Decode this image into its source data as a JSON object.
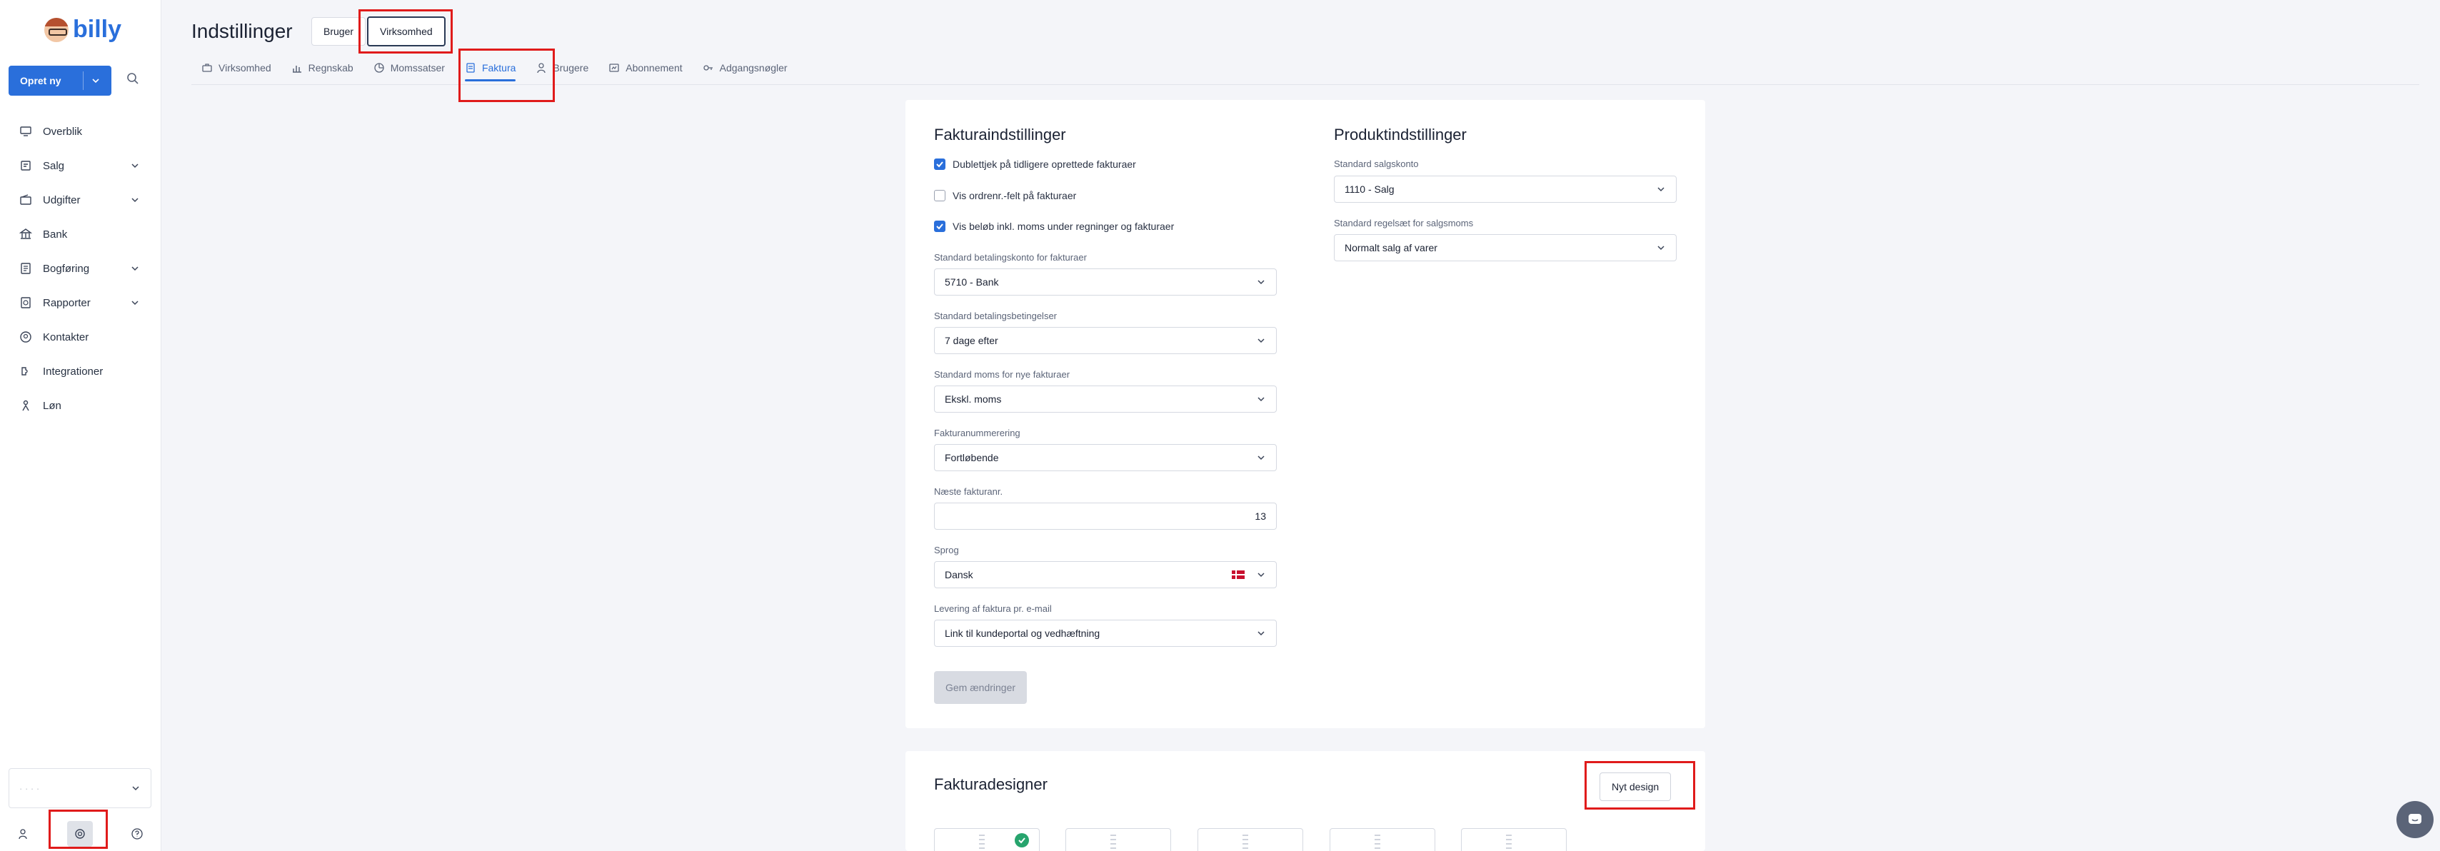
{
  "brand": {
    "name": "billy"
  },
  "sidebar": {
    "create_label": "Opret ny",
    "items": [
      {
        "label": "Overblik",
        "icon": "monitor-icon",
        "expandable": false
      },
      {
        "label": "Salg",
        "icon": "receipt-icon",
        "expandable": true
      },
      {
        "label": "Udgifter",
        "icon": "wallet-icon",
        "expandable": true
      },
      {
        "label": "Bank",
        "icon": "bank-icon",
        "expandable": false
      },
      {
        "label": "Bogføring",
        "icon": "book-icon",
        "expandable": true
      },
      {
        "label": "Rapporter",
        "icon": "report-icon",
        "expandable": true
      },
      {
        "label": "Kontakter",
        "icon": "contacts-icon",
        "expandable": false
      },
      {
        "label": "Integrationer",
        "icon": "puzzle-icon",
        "expandable": false
      },
      {
        "label": "Løn",
        "icon": "salary-icon",
        "expandable": false
      }
    ],
    "org_placeholder": "· · · ·"
  },
  "header": {
    "title": "Indstillinger",
    "seg_user": "Bruger",
    "seg_company": "Virksomhed"
  },
  "tabs": [
    {
      "label": "Virksomhed",
      "icon": "briefcase-icon"
    },
    {
      "label": "Regnskab",
      "icon": "bar-chart-icon"
    },
    {
      "label": "Momssatser",
      "icon": "pie-icon"
    },
    {
      "label": "Faktura",
      "icon": "invoice-icon"
    },
    {
      "label": "Brugere",
      "icon": "user-icon"
    },
    {
      "label": "Abonnement",
      "icon": "subscription-icon"
    },
    {
      "label": "Adgangsnøgler",
      "icon": "key-icon"
    }
  ],
  "invoice_settings": {
    "title": "Fakturaindstillinger",
    "checkboxes": [
      {
        "label": "Dublettjek på tidligere oprettede fakturaer",
        "checked": true
      },
      {
        "label": "Vis ordrenr.-felt på fakturaer",
        "checked": false
      },
      {
        "label": "Vis beløb inkl. moms under regninger og fakturaer",
        "checked": true
      }
    ],
    "fields": {
      "payment_account": {
        "label": "Standard betalingskonto for fakturaer",
        "value": "5710 - Bank"
      },
      "payment_terms": {
        "label": "Standard betalingsbetingelser",
        "value": "7 dage efter"
      },
      "vat_default": {
        "label": "Standard moms for nye fakturaer",
        "value": "Ekskl. moms"
      },
      "numbering": {
        "label": "Fakturanummerering",
        "value": "Fortløbende"
      },
      "next_number": {
        "label": "Næste fakturanr.",
        "value": "13"
      },
      "language": {
        "label": "Sprog",
        "value": "Dansk"
      },
      "delivery": {
        "label": "Levering af faktura pr. e-mail",
        "value": "Link til kundeportal og vedhæftning"
      }
    },
    "save_label": "Gem ændringer"
  },
  "product_settings": {
    "title": "Produktindstillinger",
    "sales_account": {
      "label": "Standard salgskonto",
      "value": "1110 - Salg"
    },
    "vat_rule": {
      "label": "Standard regelsæt for salgsmoms",
      "value": "Normalt salg af varer"
    }
  },
  "invoice_designs": {
    "title": "Fakturadesigner",
    "new_label": "Nyt design"
  },
  "colors": {
    "accent": "#2a6fdb",
    "success": "#27a46d",
    "highlight": "#e01b1b"
  }
}
